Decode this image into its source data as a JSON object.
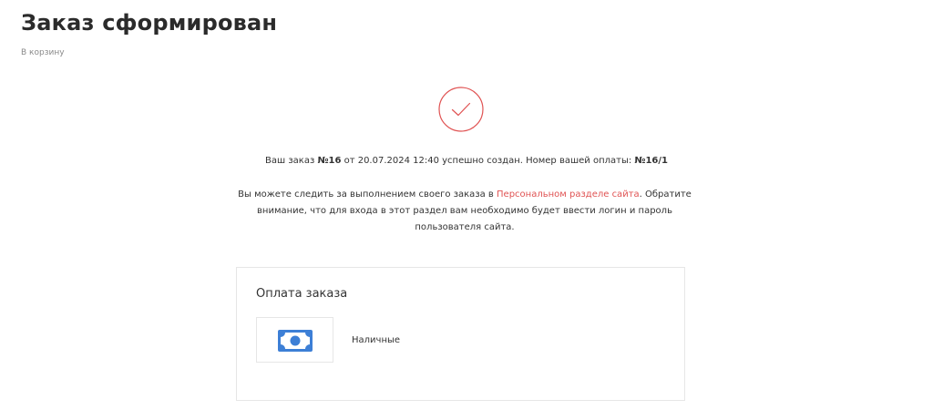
{
  "header": {
    "title": "Заказ сформирован",
    "breadcrumb": "В корзину"
  },
  "status": {
    "icon": "check-circle-icon",
    "accent_color": "#e05353"
  },
  "order": {
    "prefix": "Ваш заказ ",
    "number": "№16",
    "middle": " от 20.07.2024 12:40 успешно создан. Номер вашей оплаты: ",
    "payment_number": "№16/1"
  },
  "info": {
    "text_before_link": "Вы можете следить за выполнением своего заказа в ",
    "link_text": "Персональном разделе сайта",
    "text_after_link": ". Обратите внимание, что для входа в этот раздел вам необходимо будет ввести логин и пароль пользователя сайта."
  },
  "payment": {
    "title": "Оплата заказа",
    "method_label": "Наличные",
    "method_icon": "cash-icon",
    "icon_color": "#3d7fd6"
  }
}
